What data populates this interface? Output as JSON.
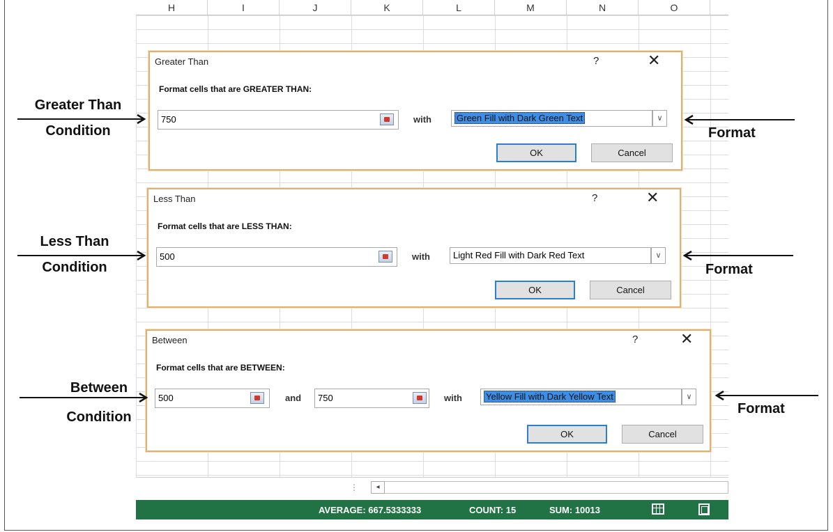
{
  "columns": [
    "H",
    "I",
    "J",
    "K",
    "L",
    "M",
    "N",
    "O"
  ],
  "dialogs": [
    {
      "title": "Greater Than",
      "help": "?",
      "close": "✕",
      "prompt": "Format cells that are GREATER THAN:",
      "value1": "750",
      "with_label": "with",
      "format": "Green Fill with Dark Green Text",
      "format_highlighted": true,
      "ok": "OK",
      "cancel": "Cancel"
    },
    {
      "title": "Less Than",
      "help": "?",
      "close": "✕",
      "prompt": "Format cells that are LESS THAN:",
      "value1": "500",
      "with_label": "with",
      "format": "Light Red Fill with Dark Red Text",
      "format_highlighted": false,
      "ok": "OK",
      "cancel": "Cancel"
    },
    {
      "title": "Between",
      "help": "?",
      "close": "✕",
      "prompt": "Format cells that are BETWEEN:",
      "value1": "500",
      "and_label": "and",
      "value2": "750",
      "with_label": "with",
      "format": "Yellow Fill with Dark Yellow Text",
      "format_highlighted": true,
      "ok": "OK",
      "cancel": "Cancel"
    }
  ],
  "annotations": {
    "greater_than_condition": [
      "Greater Than",
      "Condition"
    ],
    "less_than_condition": [
      "Less Than",
      "Condition"
    ],
    "between_condition": [
      "Between",
      "Condition"
    ],
    "format": "Format"
  },
  "statusbar": {
    "average": "AVERAGE: 667.5333333",
    "count": "COUNT: 15",
    "sum": "SUM: 10013"
  },
  "scrollbar": {
    "dots": "⋮",
    "left_arrow": "◂"
  },
  "colors": {
    "statusbar": "#217346",
    "dialog_border": "#e0b070",
    "ok_border": "#2a7fd4",
    "highlight": "#3d8ee6"
  }
}
